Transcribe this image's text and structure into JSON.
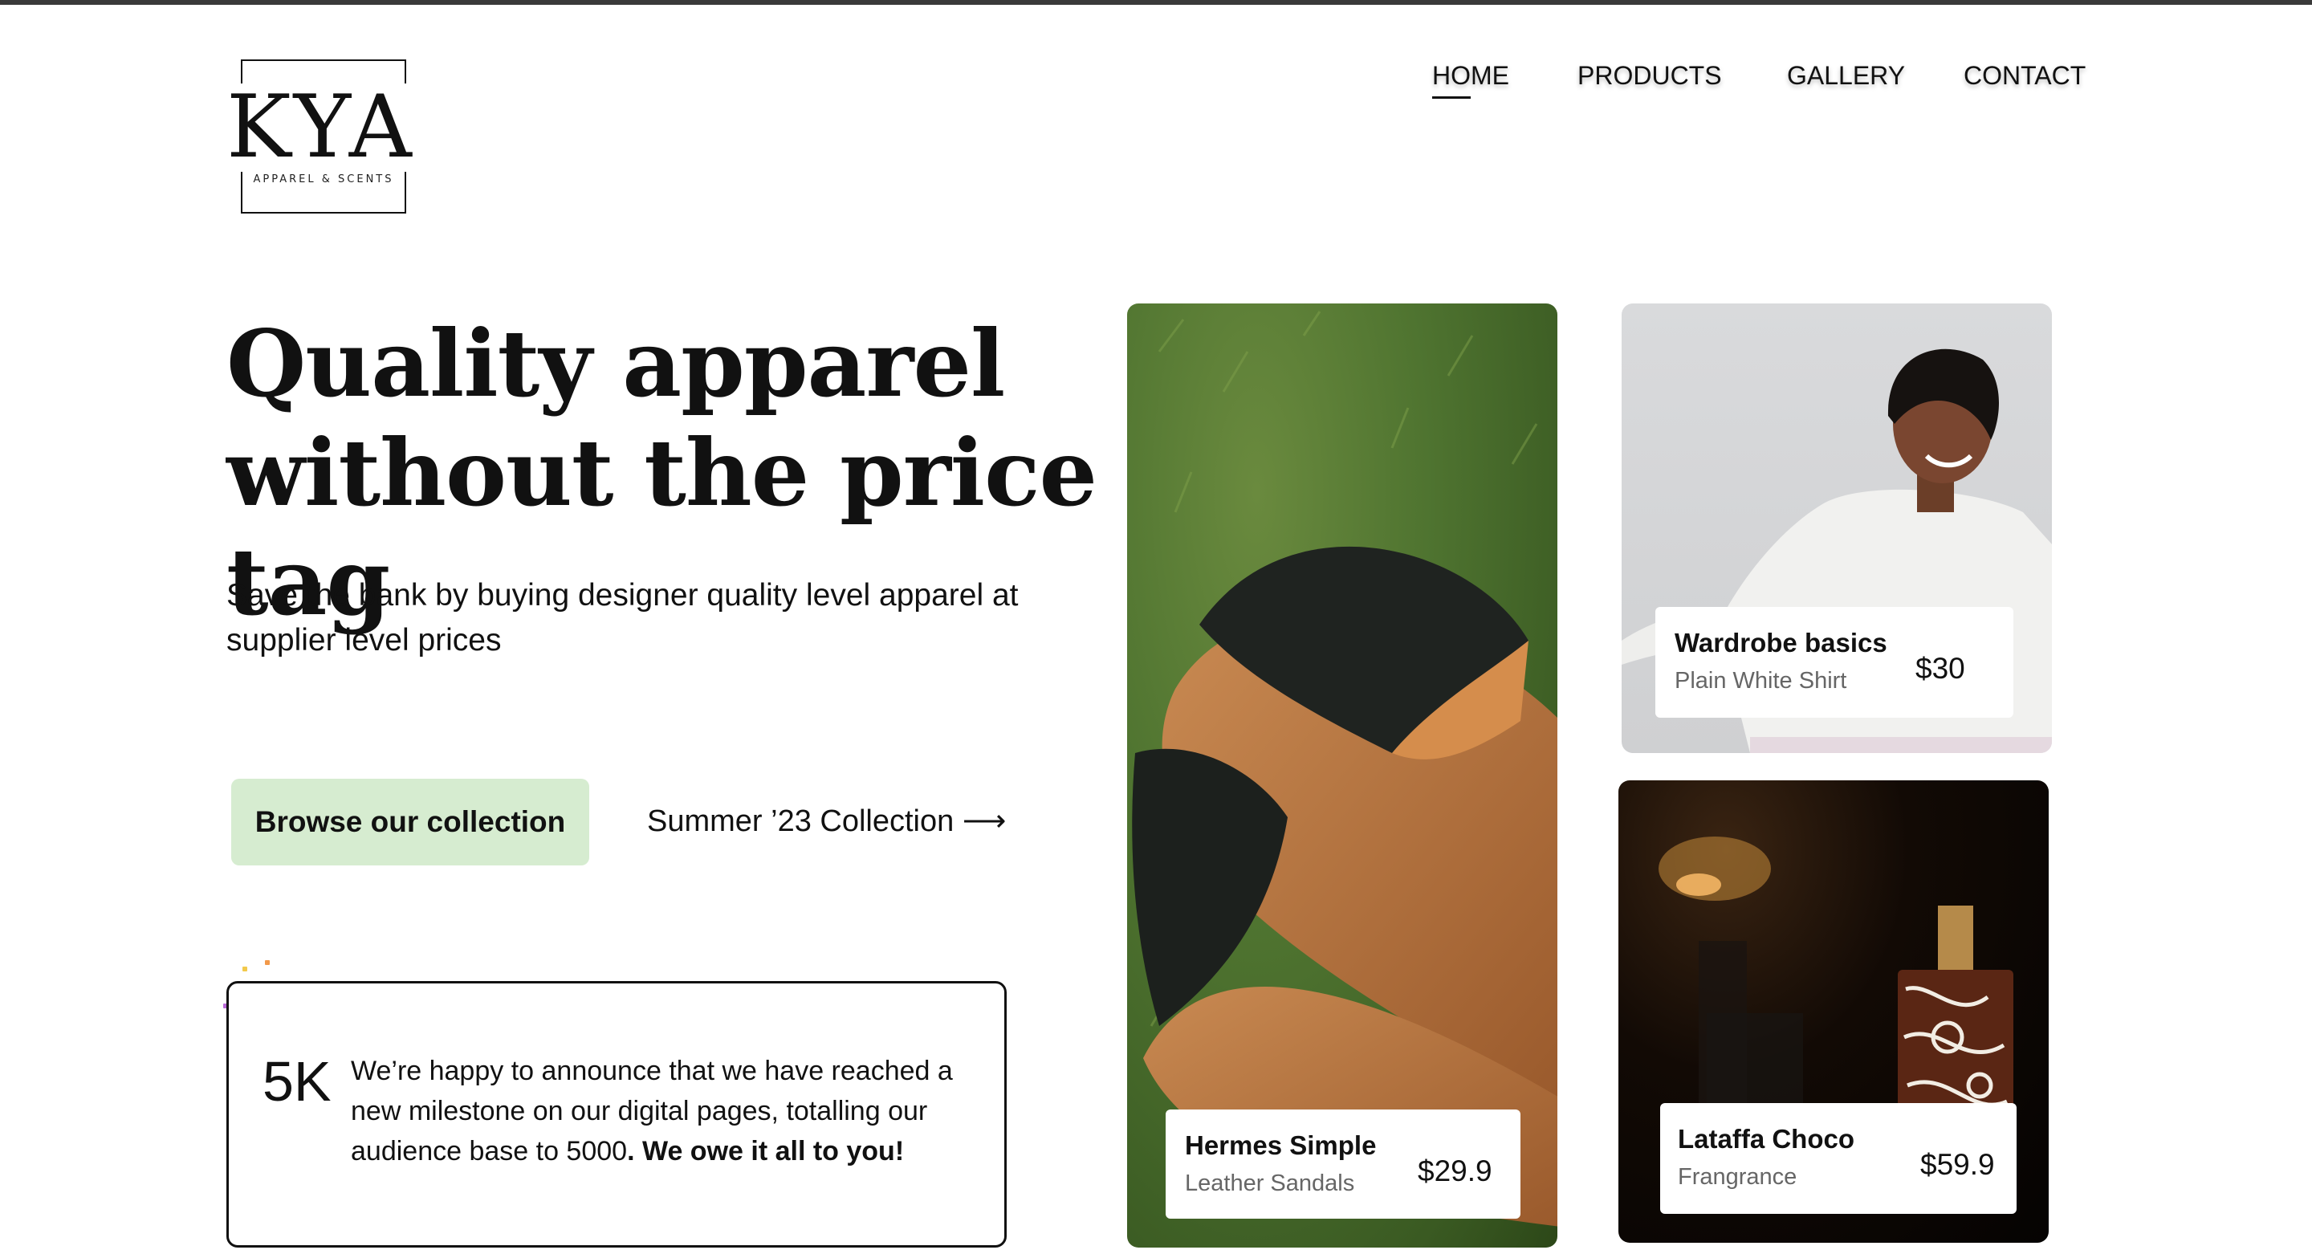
{
  "logo": {
    "wordmark": "KYA",
    "tagline": "APPAREL & SCENTS"
  },
  "nav": {
    "items": [
      {
        "label": "HOME",
        "active": true
      },
      {
        "label": "PRODUCTS",
        "active": false
      },
      {
        "label": "GALLERY",
        "active": false
      },
      {
        "label": "CONTACT",
        "active": false
      }
    ]
  },
  "hero": {
    "title_line1": "Quality apparel",
    "title_line2": "without the price tag",
    "subtitle": "Save the bank by buying designer quality level apparel at supplier level prices",
    "primary_button": "Browse our collection",
    "secondary_link": "Summer ’23 Collection ⟶"
  },
  "milestone": {
    "number": "5K",
    "text": "We’re happy to announce that we have reached a new milestone on our digital  pages, totalling our audience base to 5000",
    "bold_text": ". We owe it all to you!"
  },
  "products": [
    {
      "title": "Hermes Simple",
      "subtitle": "Leather Sandals",
      "price": "$29.9"
    },
    {
      "title": "Wardrobe basics",
      "subtitle": "Plain White Shirt",
      "price": "$30"
    },
    {
      "title": "Lataffa Choco",
      "subtitle": "Frangrance",
      "price": "$59.9"
    }
  ],
  "colors": {
    "accent_button": "#d6ecd0",
    "text": "#111111",
    "topbar": "#3a3a3a"
  }
}
